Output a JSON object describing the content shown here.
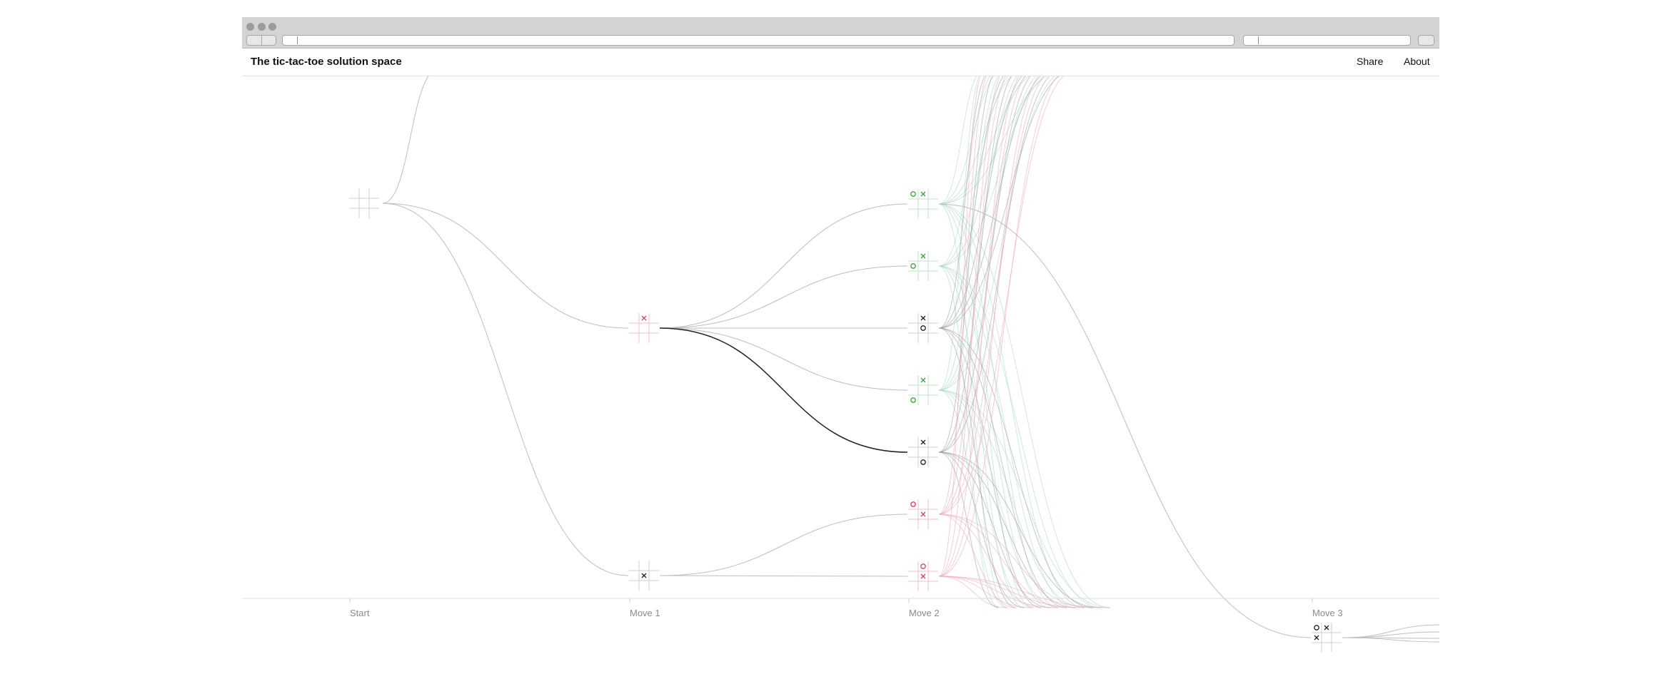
{
  "browser": {
    "address_value": "",
    "search_value": ""
  },
  "header": {
    "title": "The tic-tac-toe solution space",
    "share_label": "Share",
    "about_label": "About"
  },
  "axis": {
    "labels": [
      "Start",
      "Move 1",
      "Move 2",
      "Move 3"
    ]
  },
  "colors": {
    "win_x": "#d0455f",
    "win_o": "#3da23d",
    "neutral": "#222222",
    "grid": "#cfcfcf",
    "link": "#bdbdbd"
  },
  "icons": [
    "x-mark",
    "o-mark",
    "board-grid"
  ],
  "nodes": {
    "start": {
      "label": "Start",
      "cells": [
        "",
        "",
        "",
        "",
        "",
        "",
        "",
        "",
        ""
      ],
      "tone": "neutral"
    },
    "m1_top": {
      "cells": [
        "",
        "X",
        "",
        "",
        "",
        "",
        "",
        "",
        ""
      ],
      "tone": "x"
    },
    "m1_center": {
      "cells": [
        "",
        "",
        "",
        "",
        "X",
        "",
        "",
        "",
        ""
      ],
      "tone": "neutral"
    },
    "m2": [
      {
        "cells": [
          "O",
          "X",
          "",
          "",
          "",
          "",
          "",
          "",
          ""
        ],
        "tone": "o"
      },
      {
        "cells": [
          "",
          "X",
          "",
          "O",
          "",
          "",
          "",
          "",
          ""
        ],
        "tone": "o"
      },
      {
        "cells": [
          "",
          "X",
          "",
          "",
          "O",
          "",
          "",
          "",
          ""
        ],
        "tone": "neutral"
      },
      {
        "cells": [
          "",
          "X",
          "",
          "",
          "",
          "",
          "O",
          "",
          ""
        ],
        "tone": "o"
      },
      {
        "cells": [
          "",
          "X",
          "",
          "",
          "",
          "",
          "",
          "O",
          ""
        ],
        "tone": "neutral"
      },
      {
        "cells": [
          "O",
          "",
          "",
          "",
          "X",
          "",
          "",
          "",
          ""
        ],
        "tone": "x"
      },
      {
        "cells": [
          "",
          "O",
          "",
          "",
          "X",
          "",
          "",
          "",
          ""
        ],
        "tone": "x"
      }
    ],
    "m3": {
      "cells": [
        "O",
        "X",
        "",
        "X",
        "",
        "",
        "",
        "",
        ""
      ],
      "tone": "neutral"
    }
  }
}
